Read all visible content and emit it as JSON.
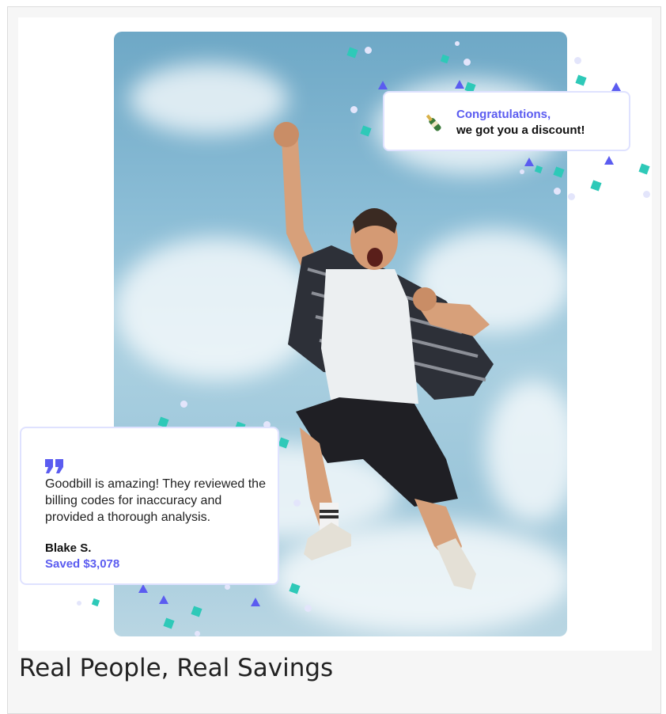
{
  "congrats": {
    "title": "Congratulations,",
    "subtitle": "we got you a discount!",
    "icon": "champagne-bottle-icon"
  },
  "review": {
    "quote_icon": "quote-icon",
    "text": "Goodbill is amazing! They reviewed the billing codes for inaccuracy and provided a thorough analysis.",
    "name": "Blake S.",
    "saved": "Saved $3,078"
  },
  "caption": "Real People, Real Savings",
  "colors": {
    "accent": "#5b5cf0",
    "confetti_teal": "#2ec9b8",
    "card_border": "#dfe2ff"
  }
}
